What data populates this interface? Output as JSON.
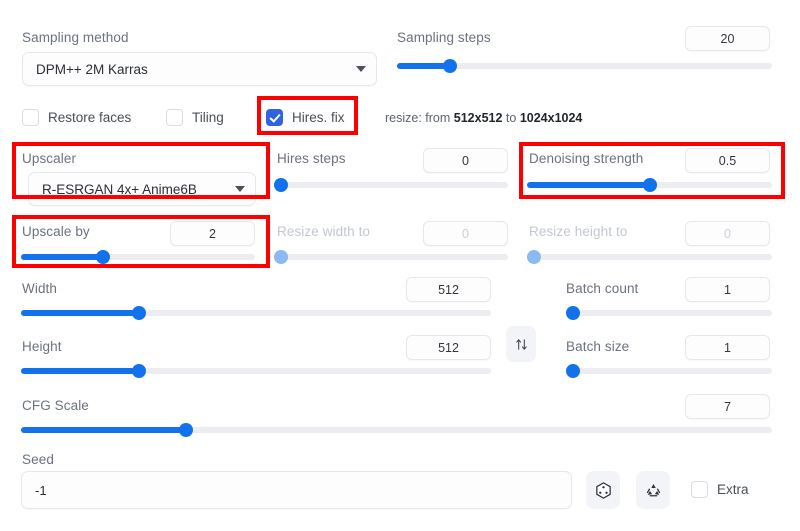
{
  "sampling": {
    "method_label": "Sampling method",
    "method_value": "DPM++ 2M Karras",
    "steps_label": "Sampling steps",
    "steps_value": "20"
  },
  "toggles": {
    "restore_faces": "Restore faces",
    "tiling": "Tiling",
    "hires_fix": "Hires. fix"
  },
  "resize_note": {
    "prefix": "resize: from ",
    "from": "512x512",
    "middle": " to ",
    "to": "1024x1024"
  },
  "hires": {
    "upscaler_label": "Upscaler",
    "upscaler_value": "R-ESRGAN 4x+ Anime6B",
    "hires_steps_label": "Hires steps",
    "hires_steps_value": "0",
    "denoising_label": "Denoising strength",
    "denoising_value": "0.5",
    "upscale_by_label": "Upscale by",
    "upscale_by_value": "2",
    "resize_width_label": "Resize width to",
    "resize_width_value": "0",
    "resize_height_label": "Resize height to",
    "resize_height_value": "0"
  },
  "dimensions": {
    "width_label": "Width",
    "width_value": "512",
    "height_label": "Height",
    "height_value": "512",
    "swap_icon": "swap-dimensions-icon"
  },
  "batch": {
    "count_label": "Batch count",
    "count_value": "1",
    "size_label": "Batch size",
    "size_value": "1"
  },
  "cfg": {
    "label": "CFG Scale",
    "value": "7"
  },
  "seed": {
    "label": "Seed",
    "value": "-1",
    "dice_icon": "dice-randomize-icon",
    "recycle_icon": "recycle-reuse-seed-icon",
    "extra_label": "Extra"
  },
  "colors": {
    "accent": "#1272ec",
    "accent_dim": "#8bb9f2",
    "checkbox_checked": "#3063e0",
    "highlight": "#ff0000",
    "label_text": "#6b7280",
    "label_dim": "#c3c8d0"
  },
  "highlights": [
    "hires-fix-checkbox-highlight",
    "upscaler-highlight",
    "denoising-strength-highlight",
    "upscale-by-highlight"
  ],
  "slider_fills": {
    "sampling_steps_pct": 14,
    "hires_steps_pct": 0,
    "denoising_pct": 50,
    "upscale_by_pct": 35,
    "resize_width_pct": 0,
    "resize_height_pct": 0,
    "width_pct": 25,
    "height_pct": 25,
    "batch_count_pct": 0,
    "batch_size_pct": 0,
    "cfg_pct": 22
  }
}
